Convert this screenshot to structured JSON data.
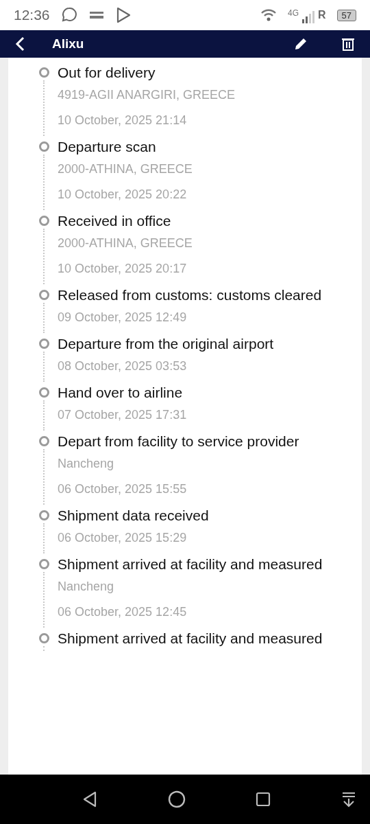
{
  "status_bar": {
    "time": "12:36",
    "network": "4G",
    "roaming": "R",
    "battery": "57"
  },
  "app_bar": {
    "title": "Alixu"
  },
  "events": [
    {
      "title": "Out for delivery",
      "location": "4919-AGII ANARGIRI, GREECE",
      "time": "10 October, 2025 21:14"
    },
    {
      "title": "Departure scan",
      "location": "2000-ATHINA, GREECE",
      "time": "10 October, 2025 20:22"
    },
    {
      "title": "Received in office",
      "location": "2000-ATHINA, GREECE",
      "time": "10 October, 2025 20:17"
    },
    {
      "title": "Released from customs: customs cleared",
      "time": "09 October, 2025 12:49"
    },
    {
      "title": "Departure from the original airport",
      "time": "08 October, 2025 03:53"
    },
    {
      "title": "Hand over to airline",
      "time": "07 October, 2025 17:31"
    },
    {
      "title": "Depart from facility to service provider",
      "location": "Nancheng",
      "time": "06 October, 2025 15:55"
    },
    {
      "title": "Shipment data received",
      "time": "06 October, 2025 15:29"
    },
    {
      "title": "Shipment arrived at facility and measured",
      "location": "Nancheng",
      "time": "06 October, 2025 12:45"
    },
    {
      "title": "Shipment arrived at facility and measured"
    }
  ]
}
